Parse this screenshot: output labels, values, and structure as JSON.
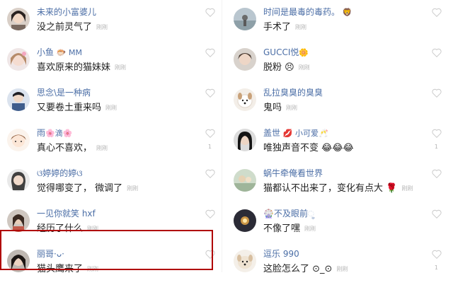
{
  "colors": {
    "name": "#4b6ea6",
    "text": "#222222",
    "meta": "#b5b5b5",
    "highlight": "#b00000"
  },
  "left_comments": [
    {
      "name": "未来的小富婆儿",
      "name_emoji": "",
      "text": "没之前灵气了",
      "time": "刚刚",
      "likes": ""
    },
    {
      "name": "小鱼",
      "name_emoji": "🐡 MM",
      "text": "喜欢原来的猫妹妹",
      "time": "刚刚",
      "likes": ""
    },
    {
      "name": "思念\\是一种病",
      "name_emoji": "",
      "text": "又要卷土重来吗",
      "time": "刚刚",
      "likes": ""
    },
    {
      "name": "雨",
      "name_emoji": "🌸滴🌸",
      "text": "真心不喜欢，",
      "time": "刚刚",
      "likes": "1"
    },
    {
      "name": "ଓ婷婷的婷ଓ",
      "name_emoji": "",
      "text": "觉得哪变了， 微调了",
      "time": "刚刚",
      "likes": ""
    },
    {
      "name": "一见你就笑 hxf",
      "name_emoji": "",
      "text": "经历了什么",
      "time": "刚刚",
      "likes": ""
    },
    {
      "name": "丽哥·ᴗ·",
      "name_emoji": "",
      "text": "猫头鹰来了",
      "time": "刚刚",
      "likes": ""
    }
  ],
  "right_comments": [
    {
      "name": "时间是最毒的毒药。",
      "name_emoji": "🦁",
      "text": "手术了",
      "time": "刚刚",
      "likes": ""
    },
    {
      "name": "GUCCI悦",
      "name_emoji": "🌼",
      "text": "脱粉 😣",
      "time": "刚刚",
      "likes": ""
    },
    {
      "name": "乱拉臭臭的臭臭",
      "name_emoji": "",
      "text": "鬼吗",
      "time": "刚刚",
      "likes": ""
    },
    {
      "name": "盖世",
      "name_emoji": "💋 小可爱🥂",
      "text": "唯独声音不变 😂😂😂",
      "time": "",
      "likes": "1"
    },
    {
      "name": "蜗牛牵俺看世界",
      "name_emoji": "",
      "text": "猫都认不出来了，变化有点大 🌹",
      "time": "刚刚",
      "likes": ""
    },
    {
      "name": "🎡不及眼前",
      "name_emoji": "ୃ",
      "text": "不像了嘿",
      "time": "刚刚",
      "likes": ""
    },
    {
      "name": "逗乐 990",
      "name_emoji": "",
      "text": "这脸怎么了 ⊙_⊙",
      "time": "刚刚",
      "likes": "1"
    }
  ]
}
